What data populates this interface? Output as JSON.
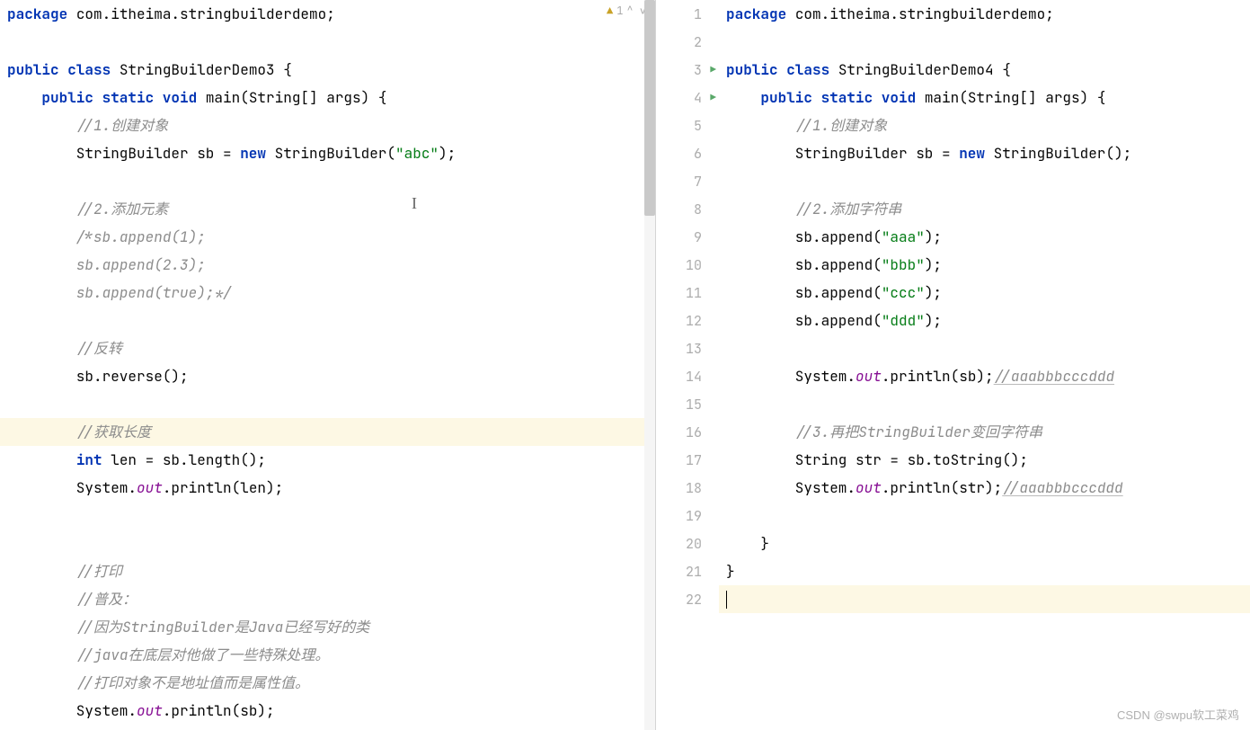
{
  "left_editor": {
    "inspection": {
      "warn_count": "1",
      "nav": "^ ∨"
    },
    "lines": [
      {
        "type": "code",
        "tokens": [
          {
            "cls": "keyword",
            "t": "package "
          },
          {
            "cls": "plain",
            "t": "com.itheima.stringbuilderdemo;"
          }
        ]
      },
      {
        "type": "blank"
      },
      {
        "type": "code",
        "tokens": [
          {
            "cls": "keyword",
            "t": "public class "
          },
          {
            "cls": "plain",
            "t": "StringBuilderDemo3 {"
          }
        ]
      },
      {
        "type": "code",
        "tokens": [
          {
            "cls": "plain",
            "t": "    "
          },
          {
            "cls": "keyword",
            "t": "public static void "
          },
          {
            "cls": "plain",
            "t": "main(String[] args) {"
          }
        ]
      },
      {
        "type": "code",
        "tokens": [
          {
            "cls": "plain",
            "t": "        "
          },
          {
            "cls": "comment-italic",
            "t": "//1.创建对象"
          }
        ]
      },
      {
        "type": "code",
        "tokens": [
          {
            "cls": "plain",
            "t": "        StringBuilder sb = "
          },
          {
            "cls": "keyword",
            "t": "new "
          },
          {
            "cls": "plain",
            "t": "StringBuilder("
          },
          {
            "cls": "string",
            "t": "\"abc\""
          },
          {
            "cls": "plain",
            "t": ");"
          }
        ]
      },
      {
        "type": "blank"
      },
      {
        "type": "code",
        "tokens": [
          {
            "cls": "plain",
            "t": "        "
          },
          {
            "cls": "comment-italic",
            "t": "//2.添加元素"
          }
        ]
      },
      {
        "type": "code",
        "tokens": [
          {
            "cls": "plain",
            "t": "        "
          },
          {
            "cls": "comment-italic",
            "t": "/*sb.append(1);"
          }
        ]
      },
      {
        "type": "code",
        "tokens": [
          {
            "cls": "plain",
            "t": "        "
          },
          {
            "cls": "comment-italic",
            "t": "sb.append(2.3);"
          }
        ]
      },
      {
        "type": "code",
        "tokens": [
          {
            "cls": "plain",
            "t": "        "
          },
          {
            "cls": "comment-italic",
            "t": "sb.append(true);*/"
          }
        ]
      },
      {
        "type": "blank"
      },
      {
        "type": "code",
        "tokens": [
          {
            "cls": "plain",
            "t": "        "
          },
          {
            "cls": "comment-italic",
            "t": "//反转"
          }
        ]
      },
      {
        "type": "code",
        "tokens": [
          {
            "cls": "plain",
            "t": "        sb.reverse();"
          }
        ]
      },
      {
        "type": "blank"
      },
      {
        "type": "code",
        "highlight": true,
        "tokens": [
          {
            "cls": "plain",
            "t": "        "
          },
          {
            "cls": "comment-italic",
            "t": "//获取长度"
          }
        ]
      },
      {
        "type": "code",
        "tokens": [
          {
            "cls": "plain",
            "t": "        "
          },
          {
            "cls": "keyword",
            "t": "int "
          },
          {
            "cls": "plain",
            "t": "len = sb.length();"
          }
        ]
      },
      {
        "type": "code",
        "tokens": [
          {
            "cls": "plain",
            "t": "        System."
          },
          {
            "cls": "field",
            "t": "out"
          },
          {
            "cls": "plain",
            "t": ".println(len);"
          }
        ]
      },
      {
        "type": "blank"
      },
      {
        "type": "blank"
      },
      {
        "type": "code",
        "tokens": [
          {
            "cls": "plain",
            "t": "        "
          },
          {
            "cls": "comment-italic",
            "t": "//打印"
          }
        ]
      },
      {
        "type": "code",
        "tokens": [
          {
            "cls": "plain",
            "t": "        "
          },
          {
            "cls": "comment-italic",
            "t": "//普及："
          }
        ]
      },
      {
        "type": "code",
        "tokens": [
          {
            "cls": "plain",
            "t": "        "
          },
          {
            "cls": "comment-italic",
            "t": "//因为StringBuilder是Java已经写好的类"
          }
        ]
      },
      {
        "type": "code",
        "tokens": [
          {
            "cls": "plain",
            "t": "        "
          },
          {
            "cls": "comment-italic",
            "t": "//java在底层对他做了一些特殊处理。"
          }
        ]
      },
      {
        "type": "code",
        "tokens": [
          {
            "cls": "plain",
            "t": "        "
          },
          {
            "cls": "comment-italic",
            "t": "//打印对象不是地址值而是属性值。"
          }
        ]
      },
      {
        "type": "code",
        "tokens": [
          {
            "cls": "plain",
            "t": "        System."
          },
          {
            "cls": "field",
            "t": "out"
          },
          {
            "cls": "plain",
            "t": ".println(sb);"
          }
        ]
      }
    ]
  },
  "right_editor": {
    "lines": [
      {
        "num": "1",
        "tokens": [
          {
            "cls": "keyword",
            "t": "package "
          },
          {
            "cls": "plain",
            "t": "com.itheima.stringbuilderdemo;"
          }
        ]
      },
      {
        "num": "2",
        "tokens": []
      },
      {
        "num": "3",
        "run": true,
        "tokens": [
          {
            "cls": "keyword",
            "t": "public class "
          },
          {
            "cls": "plain",
            "t": "StringBuilderDemo4 {"
          }
        ]
      },
      {
        "num": "4",
        "run": true,
        "tokens": [
          {
            "cls": "plain",
            "t": "    "
          },
          {
            "cls": "keyword",
            "t": "public static void "
          },
          {
            "cls": "plain",
            "t": "main(String[] args) {"
          }
        ]
      },
      {
        "num": "5",
        "tokens": [
          {
            "cls": "plain",
            "t": "        "
          },
          {
            "cls": "comment-italic",
            "t": "//1.创建对象"
          }
        ]
      },
      {
        "num": "6",
        "tokens": [
          {
            "cls": "plain",
            "t": "        StringBuilder sb = "
          },
          {
            "cls": "keyword",
            "t": "new "
          },
          {
            "cls": "plain",
            "t": "StringBuilder();"
          }
        ]
      },
      {
        "num": "7",
        "tokens": []
      },
      {
        "num": "8",
        "tokens": [
          {
            "cls": "plain",
            "t": "        "
          },
          {
            "cls": "comment-italic",
            "t": "//2.添加字符串"
          }
        ]
      },
      {
        "num": "9",
        "tokens": [
          {
            "cls": "plain",
            "t": "        sb.append("
          },
          {
            "cls": "string",
            "t": "\"aaa\""
          },
          {
            "cls": "plain",
            "t": ");"
          }
        ]
      },
      {
        "num": "10",
        "tokens": [
          {
            "cls": "plain",
            "t": "        sb.append("
          },
          {
            "cls": "string",
            "t": "\"bbb\""
          },
          {
            "cls": "plain",
            "t": ");"
          }
        ]
      },
      {
        "num": "11",
        "tokens": [
          {
            "cls": "plain",
            "t": "        sb.append("
          },
          {
            "cls": "string",
            "t": "\"ccc\""
          },
          {
            "cls": "plain",
            "t": ");"
          }
        ]
      },
      {
        "num": "12",
        "tokens": [
          {
            "cls": "plain",
            "t": "        sb.append("
          },
          {
            "cls": "string",
            "t": "\"ddd\""
          },
          {
            "cls": "plain",
            "t": ");"
          }
        ]
      },
      {
        "num": "13",
        "tokens": []
      },
      {
        "num": "14",
        "tokens": [
          {
            "cls": "plain",
            "t": "        System."
          },
          {
            "cls": "field",
            "t": "out"
          },
          {
            "cls": "plain",
            "t": ".println(sb);"
          },
          {
            "cls": "comment-italic underline",
            "t": "//aaabbbcccddd"
          }
        ]
      },
      {
        "num": "15",
        "tokens": []
      },
      {
        "num": "16",
        "tokens": [
          {
            "cls": "plain",
            "t": "        "
          },
          {
            "cls": "comment-italic",
            "t": "//3.再把StringBuilder变回字符串"
          }
        ]
      },
      {
        "num": "17",
        "tokens": [
          {
            "cls": "plain",
            "t": "        String str = sb.toString();"
          }
        ]
      },
      {
        "num": "18",
        "tokens": [
          {
            "cls": "plain",
            "t": "        System."
          },
          {
            "cls": "field",
            "t": "out"
          },
          {
            "cls": "plain",
            "t": ".println(str);"
          },
          {
            "cls": "comment-italic underline",
            "t": "//aaabbbcccddd"
          }
        ]
      },
      {
        "num": "19",
        "tokens": []
      },
      {
        "num": "20",
        "tokens": [
          {
            "cls": "plain",
            "t": "    }"
          }
        ]
      },
      {
        "num": "21",
        "tokens": [
          {
            "cls": "plain",
            "t": "}"
          }
        ]
      },
      {
        "num": "22",
        "highlight": true,
        "caret": true,
        "tokens": []
      }
    ]
  },
  "watermark": "CSDN @swpu软工菜鸡"
}
